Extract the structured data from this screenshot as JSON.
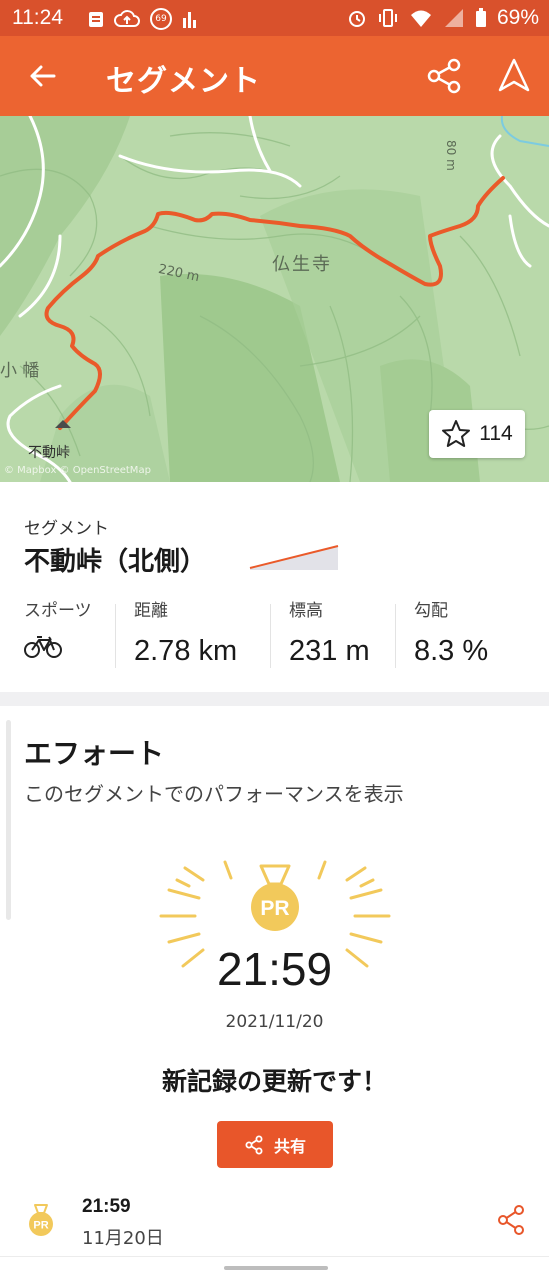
{
  "status_bar": {
    "time": "11:24",
    "badge": "69",
    "battery": "69%"
  },
  "app_bar": {
    "title": "セグメント"
  },
  "map": {
    "labels": {
      "temple": "仏生寺",
      "contour_220": "220 m",
      "contour_80": "80 m",
      "village": "小 幡",
      "peak": "不動峠"
    },
    "attribution": "© Mapbox © OpenStreetMap",
    "star_count": "114",
    "route_color": "#ea5a2a"
  },
  "segment": {
    "kind_label": "セグメント",
    "name": "不動峠（北側）",
    "stats": [
      {
        "label": "スポーツ",
        "value": "",
        "icon": "bicycle-icon"
      },
      {
        "label": "距離",
        "value": "2.78 km"
      },
      {
        "label": "標高",
        "value": "231 m"
      },
      {
        "label": "勾配",
        "value": "8.3 %"
      }
    ]
  },
  "effort": {
    "title": "エフォート",
    "subtitle": "このセグメントでのパフォーマンスを表示",
    "medal_text": "PR",
    "time": "21:59",
    "date": "2021/11/20",
    "message": "新記録の更新です！",
    "share_label": "共有",
    "accent": "#f2c95b"
  },
  "effort_row": {
    "medal_text": "PR",
    "time": "21:59",
    "date": "11月20日"
  },
  "colors": {
    "brand": "#ec6431",
    "status_bar": "#d9512c",
    "button": "#e8562a"
  }
}
